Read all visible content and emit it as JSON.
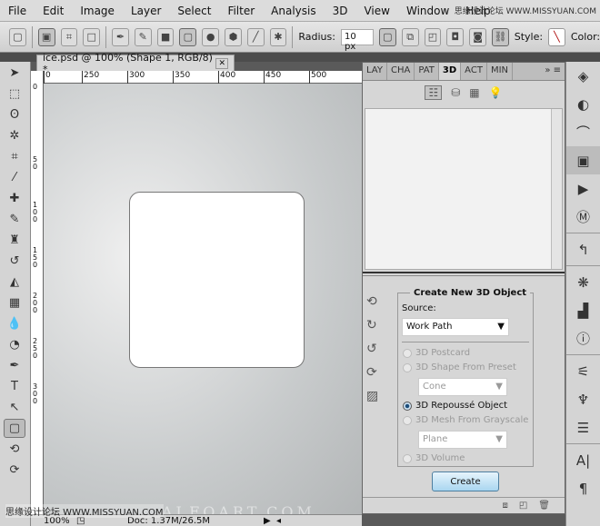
{
  "menu": [
    "File",
    "Edit",
    "Image",
    "Layer",
    "Select",
    "Filter",
    "Analysis",
    "3D",
    "View",
    "Window",
    "Help"
  ],
  "watermark": "思缘设计论坛 WWW.MISSYUAN.COM",
  "options": {
    "radius_label": "Radius:",
    "radius_value": "10 px",
    "style_label": "Style:",
    "color_label": "Color:"
  },
  "document": {
    "tab_title": "ice.psd @ 100% (Shape 1, RGB/8) *",
    "close": "✕",
    "ruler_h": [
      "0",
      "250",
      "300",
      "350",
      "400",
      "450",
      "500"
    ],
    "ruler_v": [
      "0",
      "5",
      "0",
      "1",
      "0",
      "0",
      "1",
      "5",
      "0",
      "2",
      "0",
      "0",
      "2",
      "5",
      "0",
      "3",
      "0",
      "0"
    ],
    "canvas_watermark": "ALFOART.COM"
  },
  "status": {
    "zoom": "100%",
    "doc": "Doc: 1.37M/26.5M"
  },
  "panel": {
    "tabs": [
      "LAY",
      "CHA",
      "PAT",
      "3D",
      "ACT",
      "MIN"
    ],
    "active_tab": "3D",
    "group_title": "Create New 3D Object",
    "source_label": "Source:",
    "source_value": "Work Path",
    "options": [
      {
        "label": "3D Postcard",
        "enabled": false,
        "checked": false
      },
      {
        "label": "3D Shape From Preset",
        "enabled": false,
        "checked": false
      },
      {
        "label": "3D Repoussé Object",
        "enabled": true,
        "checked": true
      },
      {
        "label": "3D Mesh From Grayscale",
        "enabled": false,
        "checked": false
      },
      {
        "label": "3D Volume",
        "enabled": false,
        "checked": false
      }
    ],
    "preset_value": "Cone",
    "mesh_value": "Plane",
    "create_label": "Create"
  }
}
